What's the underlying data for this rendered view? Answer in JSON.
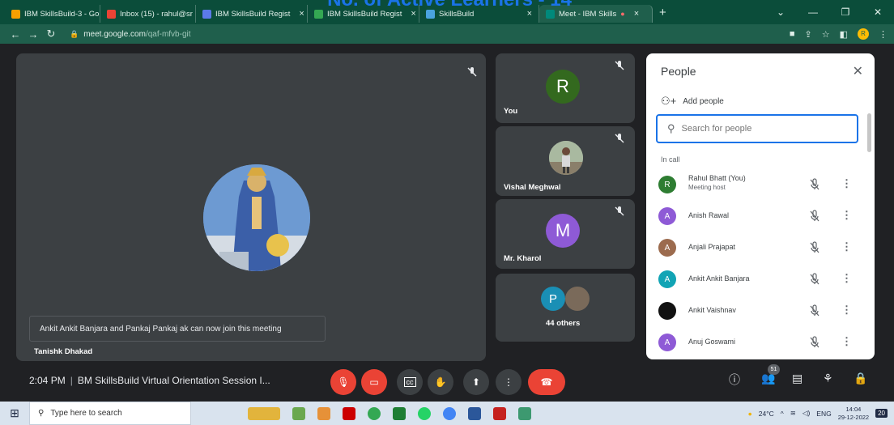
{
  "banner": {
    "text": "No. of Active Learners - 14"
  },
  "browser": {
    "tabs": [
      {
        "label": "IBM SkillsBuild-3 - Go",
        "fav": "#f6a000"
      },
      {
        "label": "Inbox (15) - rahul@sr",
        "fav": "#ea4335"
      },
      {
        "label": "IBM SkillsBuild Regist",
        "fav": "#5b7ae8"
      },
      {
        "label": "IBM SkillsBuild Regist",
        "fav": "#34a853"
      },
      {
        "label": "SkillsBuild",
        "fav": "#4aa3df"
      },
      {
        "label": "Meet - IBM Skills",
        "fav": "#00897b",
        "active": true
      }
    ],
    "url_host": "meet.google.com",
    "url_path": "/qaf-mfvb-git"
  },
  "stage": {
    "main_tile_name": "Tanishk Dhakad",
    "toast": "Ankit Ankit Banjara and Pankaj Pankaj ak can now join this meeting",
    "side_tiles": [
      {
        "name": "You",
        "initial": "R",
        "color": "#33691e"
      },
      {
        "name": "Vishal Meghwal",
        "initial": "",
        "color": ""
      },
      {
        "name": "Mr. Kharol",
        "initial": "M",
        "color": "#8e5ad6"
      },
      {
        "name": "44 others",
        "initial": "P",
        "color": "#1a8fb5"
      }
    ]
  },
  "people": {
    "title": "People",
    "add_label": "Add people",
    "search_placeholder": "Search for people",
    "section": "In call",
    "list": [
      {
        "name": "Rahul Bhatt (You)",
        "sub": "Meeting host",
        "initial": "R",
        "color": "#2e7d32"
      },
      {
        "name": "Anish Rawal",
        "sub": "",
        "initial": "A",
        "color": "#8e5ad6"
      },
      {
        "name": "Anjali Prajapat",
        "sub": "",
        "initial": "A",
        "color": "#9c6b4e"
      },
      {
        "name": "Ankit Ankit Banjara",
        "sub": "",
        "initial": "A",
        "color": "#12a4b5"
      },
      {
        "name": "Ankit Vaishnav",
        "sub": "",
        "initial": "",
        "color": "#111111"
      },
      {
        "name": "Anuj Goswami",
        "sub": "",
        "initial": "A",
        "color": "#8e5ad6"
      }
    ]
  },
  "bottom": {
    "time": "2:04 PM",
    "meeting_title": "BM SkillsBuild Virtual Orientation Session I...",
    "participant_count": "51"
  },
  "taskbar": {
    "search_placeholder": "Type here to search",
    "temp": "24°C",
    "lang": "ENG",
    "time": "14:04",
    "date": "29-12-2022",
    "notif": "20"
  }
}
